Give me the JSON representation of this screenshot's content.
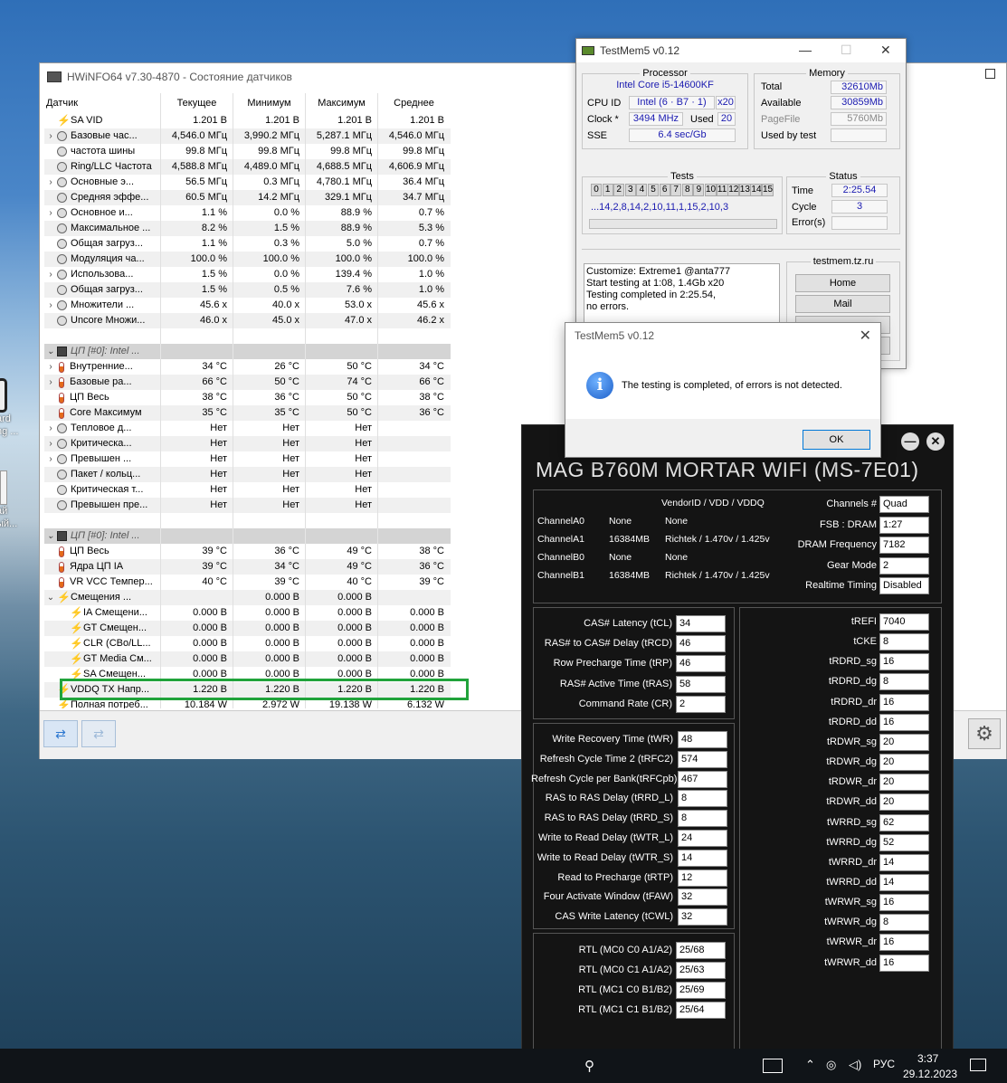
{
  "desktop": {
    "icon1_label": "ard\nng ...",
    "icon2_label": "ай\nый..."
  },
  "hwinfo": {
    "title": "HWiNFO64 v7.30-4870 - Состояние датчиков",
    "columns": [
      "Датчик",
      "Текущее",
      "Минимум",
      "Максимум",
      "Среднее"
    ],
    "rows": [
      {
        "type": "row",
        "icon": "bolt",
        "ind": 0,
        "chev": "",
        "name": "SA VID",
        "v": [
          "1.201 В",
          "1.201 В",
          "1.201 В",
          "1.201 В"
        ]
      },
      {
        "type": "row",
        "icon": "clock",
        "ind": 0,
        "chev": "›",
        "name": "Базовые час...",
        "v": [
          "4,546.0 МГц",
          "3,990.2 МГц",
          "5,287.1 МГц",
          "4,546.0 МГц"
        ]
      },
      {
        "type": "row",
        "icon": "clock",
        "ind": 0,
        "chev": "",
        "name": "частота шины",
        "v": [
          "99.8 МГц",
          "99.8 МГц",
          "99.8 МГц",
          "99.8 МГц"
        ]
      },
      {
        "type": "row",
        "icon": "clock",
        "ind": 0,
        "chev": "",
        "name": "Ring/LLC Частота",
        "v": [
          "4,588.8 МГц",
          "4,489.0 МГц",
          "4,688.5 МГц",
          "4,606.9 МГц"
        ]
      },
      {
        "type": "row",
        "icon": "clock",
        "ind": 0,
        "chev": "›",
        "name": "Основные э...",
        "v": [
          "56.5 МГц",
          "0.3 МГц",
          "4,780.1 МГц",
          "36.4 МГц"
        ]
      },
      {
        "type": "row",
        "icon": "clock",
        "ind": 0,
        "chev": "",
        "name": "Средняя эффе...",
        "v": [
          "60.5 МГц",
          "14.2 МГц",
          "329.1 МГц",
          "34.7 МГц"
        ]
      },
      {
        "type": "row",
        "icon": "clock",
        "ind": 0,
        "chev": "›",
        "name": "Основное и...",
        "v": [
          "1.1 %",
          "0.0 %",
          "88.9 %",
          "0.7 %"
        ]
      },
      {
        "type": "row",
        "icon": "clock",
        "ind": 0,
        "chev": "",
        "name": "Максимальное ...",
        "v": [
          "8.2 %",
          "1.5 %",
          "88.9 %",
          "5.3 %"
        ]
      },
      {
        "type": "row",
        "icon": "clock",
        "ind": 0,
        "chev": "",
        "name": "Общая загруз...",
        "v": [
          "1.1 %",
          "0.3 %",
          "5.0 %",
          "0.7 %"
        ]
      },
      {
        "type": "row",
        "icon": "clock",
        "ind": 0,
        "chev": "",
        "name": "Модуляция ча...",
        "v": [
          "100.0 %",
          "100.0 %",
          "100.0 %",
          "100.0 %"
        ]
      },
      {
        "type": "row",
        "icon": "clock",
        "ind": 0,
        "chev": "›",
        "name": "Использова...",
        "v": [
          "1.5 %",
          "0.0 %",
          "139.4 %",
          "1.0 %"
        ]
      },
      {
        "type": "row",
        "icon": "clock",
        "ind": 0,
        "chev": "",
        "name": "Общая загруз...",
        "v": [
          "1.5 %",
          "0.5 %",
          "7.6 %",
          "1.0 %"
        ]
      },
      {
        "type": "row",
        "icon": "clock",
        "ind": 0,
        "chev": "›",
        "name": "Множители ...",
        "v": [
          "45.6 x",
          "40.0 x",
          "53.0 x",
          "45.6 x"
        ]
      },
      {
        "type": "row",
        "icon": "clock",
        "ind": 0,
        "chev": "",
        "name": "Uncore Множи...",
        "v": [
          "46.0 x",
          "45.0 x",
          "47.0 x",
          "46.2 x"
        ]
      },
      {
        "type": "blank",
        "v": [
          "",
          "",
          "",
          ""
        ]
      },
      {
        "type": "group",
        "icon": "chip",
        "chev": "⌄",
        "name": "ЦП [#0]: Intel ...",
        "v": [
          "",
          "",
          "",
          ""
        ]
      },
      {
        "type": "row",
        "icon": "therm",
        "ind": 0,
        "chev": "›",
        "name": "Внутренние...",
        "v": [
          "34 °C",
          "26 °C",
          "50 °C",
          "34 °C"
        ]
      },
      {
        "type": "row",
        "icon": "therm",
        "ind": 0,
        "chev": "›",
        "name": "Базовые ра...",
        "v": [
          "66 °C",
          "50 °C",
          "74 °C",
          "66 °C"
        ]
      },
      {
        "type": "row",
        "icon": "therm",
        "ind": 0,
        "chev": "",
        "name": "ЦП Весь",
        "v": [
          "38 °C",
          "36 °C",
          "50 °C",
          "38 °C"
        ]
      },
      {
        "type": "row",
        "icon": "therm",
        "ind": 0,
        "chev": "",
        "name": "Core Максимум",
        "v": [
          "35 °C",
          "35 °C",
          "50 °C",
          "36 °C"
        ]
      },
      {
        "type": "row",
        "icon": "clock",
        "ind": 0,
        "chev": "›",
        "name": "Тепловое д...",
        "v": [
          "Нет",
          "Нет",
          "Нет",
          ""
        ]
      },
      {
        "type": "row",
        "icon": "clock",
        "ind": 0,
        "chev": "›",
        "name": "Критическа...",
        "v": [
          "Нет",
          "Нет",
          "Нет",
          ""
        ]
      },
      {
        "type": "row",
        "icon": "clock",
        "ind": 0,
        "chev": "›",
        "name": "Превышен ...",
        "v": [
          "Нет",
          "Нет",
          "Нет",
          ""
        ]
      },
      {
        "type": "row",
        "icon": "clock",
        "ind": 0,
        "chev": "",
        "name": "Пакет / кольц...",
        "v": [
          "Нет",
          "Нет",
          "Нет",
          ""
        ]
      },
      {
        "type": "row",
        "icon": "clock",
        "ind": 0,
        "chev": "",
        "name": "Критическая т...",
        "v": [
          "Нет",
          "Нет",
          "Нет",
          ""
        ]
      },
      {
        "type": "row",
        "icon": "clock",
        "ind": 0,
        "chev": "",
        "name": "Превышен пре...",
        "v": [
          "Нет",
          "Нет",
          "Нет",
          ""
        ]
      },
      {
        "type": "blank",
        "v": [
          "",
          "",
          "",
          ""
        ]
      },
      {
        "type": "group",
        "icon": "chip",
        "chev": "⌄",
        "name": "ЦП [#0]: Intel ...",
        "v": [
          "",
          "",
          "",
          ""
        ]
      },
      {
        "type": "row",
        "icon": "therm",
        "ind": 0,
        "chev": "",
        "name": "ЦП Весь",
        "v": [
          "39 °C",
          "36 °C",
          "49 °C",
          "38 °C"
        ]
      },
      {
        "type": "row",
        "icon": "therm",
        "ind": 0,
        "chev": "",
        "name": "Ядра ЦП IA",
        "v": [
          "39 °C",
          "34 °C",
          "49 °C",
          "36 °C"
        ]
      },
      {
        "type": "row",
        "icon": "therm",
        "ind": 0,
        "chev": "",
        "name": "VR VCC Темпер...",
        "v": [
          "40 °C",
          "39 °C",
          "40 °C",
          "39 °C"
        ]
      },
      {
        "type": "row",
        "icon": "bolt",
        "ind": 0,
        "chev": "⌄",
        "name": "Смещения ...",
        "v": [
          "",
          "0.000 В",
          "0.000 В",
          ""
        ]
      },
      {
        "type": "row",
        "icon": "bolt",
        "ind": 1,
        "chev": "",
        "name": "IA Смещени...",
        "v": [
          "0.000 В",
          "0.000 В",
          "0.000 В",
          "0.000 В"
        ]
      },
      {
        "type": "row",
        "icon": "bolt",
        "ind": 1,
        "chev": "",
        "name": "GT Смещен...",
        "v": [
          "0.000 В",
          "0.000 В",
          "0.000 В",
          "0.000 В"
        ]
      },
      {
        "type": "row",
        "icon": "bolt",
        "ind": 1,
        "chev": "",
        "name": "CLR (CBo/LL...",
        "v": [
          "0.000 В",
          "0.000 В",
          "0.000 В",
          "0.000 В"
        ]
      },
      {
        "type": "row",
        "icon": "bolt",
        "ind": 1,
        "chev": "",
        "name": "GT Media См...",
        "v": [
          "0.000 В",
          "0.000 В",
          "0.000 В",
          "0.000 В"
        ]
      },
      {
        "type": "row",
        "icon": "bolt",
        "ind": 1,
        "chev": "",
        "name": "SA Смещен...",
        "v": [
          "0.000 В",
          "0.000 В",
          "0.000 В",
          "0.000 В"
        ]
      },
      {
        "type": "row",
        "icon": "bolt",
        "ind": 0,
        "chev": "",
        "name": "VDDQ TX Напр...",
        "v": [
          "1.220 В",
          "1.220 В",
          "1.220 В",
          "1.220 В"
        ]
      },
      {
        "type": "row",
        "icon": "bolt",
        "ind": 0,
        "chev": "",
        "name": "Полная потреб...",
        "v": [
          "10.184 W",
          "2.972 W",
          "19.138 W",
          "6.132 W"
        ]
      }
    ],
    "nav_back": "⇄",
    "nav_fwd": "⇄",
    "settings_icon": "⚙"
  },
  "testmem": {
    "title": "TestMem5 v0.12",
    "processor_legend": "Processor",
    "processor_name": "Intel Core i5-14600KF",
    "cpu_id_label": "CPU ID",
    "cpu_id": "Intel  (6 · B7 · 1)",
    "cpu_threads": "x20",
    "clock_label": "Clock *",
    "clock": "3494 MHz",
    "used_label": "Used",
    "used": "20",
    "sse_label": "SSE",
    "sse": "6.4 sec/Gb",
    "memory_legend": "Memory",
    "total_label": "Total",
    "total": "32610Mb",
    "available_label": "Available",
    "available": "30859Mb",
    "pagefile_label": "PageFile",
    "pagefile": "5760Mb",
    "usedbytest_label": "Used by test",
    "usedbytest": "",
    "tests_legend": "Tests",
    "test_nums": [
      "0",
      "1",
      "2",
      "3",
      "4",
      "5",
      "6",
      "7",
      "8",
      "9",
      "10",
      "11",
      "12",
      "13",
      "14",
      "15"
    ],
    "test_seq": "...14,2,8,14,2,10,11,1,15,2,10,3",
    "status_legend": "Status",
    "time_label": "Time",
    "time": "2:25.54",
    "cycle_label": "Cycle",
    "cycle": "3",
    "errors_label": "Error(s)",
    "errors": "",
    "log": [
      "Customize: Extreme1 @anta777",
      "Start testing at 1:08, 1.4Gb x20",
      "Testing completed in 2:25.54,",
      "no errors."
    ],
    "site_legend": "testmem.tz.ru",
    "home_btn": "Home",
    "mail_btn": "Mail"
  },
  "dialog": {
    "title": "TestMem5 v0.12",
    "message": "The testing is completed, of errors is not detected.",
    "ok": "OK",
    "icon": "i"
  },
  "msi": {
    "title": "MAG B760M MORTAR WIFI (MS-7E01)",
    "vendor_header": "VendorID / VDD / VDDQ",
    "channels": [
      {
        "name": "ChannelA0",
        "size": "None",
        "vendor": "None"
      },
      {
        "name": "ChannelA1",
        "size": "16384MB",
        "vendor": "Richtek / 1.470v / 1.425v"
      },
      {
        "name": "ChannelB0",
        "size": "None",
        "vendor": "None"
      },
      {
        "name": "ChannelB1",
        "size": "16384MB",
        "vendor": "Richtek / 1.470v / 1.425v"
      }
    ],
    "info": [
      {
        "label": "Channels #",
        "value": "Quad"
      },
      {
        "label": "FSB : DRAM",
        "value": "1:27"
      },
      {
        "label": "DRAM Frequency",
        "value": "7182"
      },
      {
        "label": "Gear Mode",
        "value": "2"
      },
      {
        "label": "Realtime Timing",
        "value": "Disabled"
      }
    ],
    "primary": [
      {
        "label": "CAS# Latency (tCL)",
        "value": "34"
      },
      {
        "label": "RAS# to CAS# Delay (tRCD)",
        "value": "46"
      },
      {
        "label": "Row Precharge Time (tRP)",
        "value": "46"
      },
      {
        "label": "RAS# Active Time (tRAS)",
        "value": "58"
      },
      {
        "label": "Command Rate (CR)",
        "value": "2"
      }
    ],
    "secondary": [
      {
        "label": "Write Recovery Time (tWR)",
        "value": "48"
      },
      {
        "label": "Refresh Cycle Time 2 (tRFC2)",
        "value": "574"
      },
      {
        "label": "Refresh Cycle per Bank(tRFCpb)",
        "value": "467"
      },
      {
        "label": "RAS to RAS Delay (tRRD_L)",
        "value": "8"
      },
      {
        "label": "RAS to RAS Delay (tRRD_S)",
        "value": "8"
      },
      {
        "label": "Write to Read Delay (tWTR_L)",
        "value": "24"
      },
      {
        "label": "Write to Read Delay (tWTR_S)",
        "value": "14"
      },
      {
        "label": "Read to Precharge (tRTP)",
        "value": "12"
      },
      {
        "label": "Four Activate Window (tFAW)",
        "value": "32"
      },
      {
        "label": "CAS Write Latency (tCWL)",
        "value": "32"
      }
    ],
    "rtl": [
      {
        "label": "RTL (MC0 C0 A1/A2)",
        "value": "25/68"
      },
      {
        "label": "RTL (MC0 C1 A1/A2)",
        "value": "25/63"
      },
      {
        "label": "RTL (MC1 C0 B1/B2)",
        "value": "25/69"
      },
      {
        "label": "RTL (MC1 C1 B1/B2)",
        "value": "25/64"
      }
    ],
    "tertiary": [
      {
        "label": "tREFI",
        "value": "7040"
      },
      {
        "label": "tCKE",
        "value": "8"
      },
      {
        "label": "tRDRD_sg",
        "value": "16"
      },
      {
        "label": "tRDRD_dg",
        "value": "8"
      },
      {
        "label": "tRDRD_dr",
        "value": "16"
      },
      {
        "label": "tRDRD_dd",
        "value": "16"
      },
      {
        "label": "tRDWR_sg",
        "value": "20"
      },
      {
        "label": "tRDWR_dg",
        "value": "20"
      },
      {
        "label": "tRDWR_dr",
        "value": "20"
      },
      {
        "label": "tRDWR_dd",
        "value": "20"
      },
      {
        "label": "tWRRD_sg",
        "value": "62"
      },
      {
        "label": "tWRRD_dg",
        "value": "52"
      },
      {
        "label": "tWRRD_dr",
        "value": "14"
      },
      {
        "label": "tWRRD_dd",
        "value": "14"
      },
      {
        "label": "tWRWR_sg",
        "value": "16"
      },
      {
        "label": "tWRWR_dg",
        "value": "8"
      },
      {
        "label": "tWRWR_dr",
        "value": "16"
      },
      {
        "label": "tWRWR_dd",
        "value": "16"
      }
    ]
  },
  "taskbar": {
    "lang": "РУС",
    "time": "3:37",
    "date": "29.12.2023"
  }
}
